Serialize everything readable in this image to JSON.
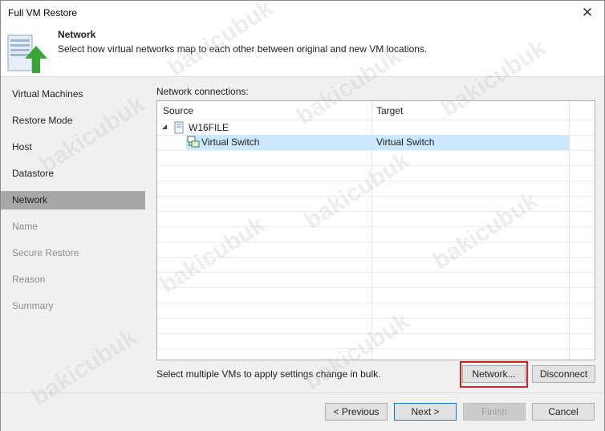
{
  "window": {
    "title": "Full VM Restore"
  },
  "header": {
    "title": "Network",
    "description": "Select how virtual networks map to each other between original and new VM locations."
  },
  "steps": [
    {
      "label": "Virtual Machines",
      "state": "done"
    },
    {
      "label": "Restore Mode",
      "state": "done"
    },
    {
      "label": "Host",
      "state": "done"
    },
    {
      "label": "Datastore",
      "state": "done"
    },
    {
      "label": "Network",
      "state": "active"
    },
    {
      "label": "Name",
      "state": "disabled"
    },
    {
      "label": "Secure Restore",
      "state": "disabled"
    },
    {
      "label": "Reason",
      "state": "disabled"
    },
    {
      "label": "Summary",
      "state": "disabled"
    }
  ],
  "network": {
    "section_label": "Network connections:",
    "columns": [
      "Source",
      "Target"
    ],
    "vm_node": "W16FILE",
    "rows": [
      {
        "source": "Virtual Switch",
        "target": "Virtual Switch"
      }
    ],
    "bulk_hint": "Select multiple VMs to apply settings change in bulk.",
    "network_button": "Network...",
    "disconnect_button": "Disconnect"
  },
  "footer": {
    "previous": "< Previous",
    "next": "Next >",
    "finish": "Finish",
    "cancel": "Cancel"
  },
  "watermark": "bakicubuk",
  "colors": {
    "selection": "#cce8ff",
    "active_step": "#a7a7a7",
    "highlight_frame": "#d41f1f",
    "arrow_green": "#3aa535"
  },
  "icons": [
    "close-icon",
    "restore-arrow-icon",
    "expand-arrow-icon",
    "vm-icon",
    "virtual-switch-icon"
  ]
}
